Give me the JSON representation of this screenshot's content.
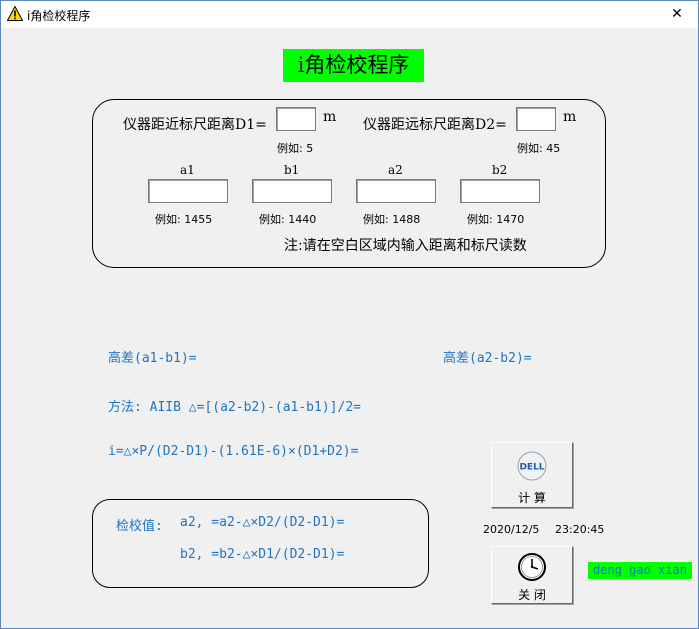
{
  "window": {
    "title": "i角检校程序",
    "close_glyph": "✕"
  },
  "header": {
    "title": "i角检校程序"
  },
  "inputs": {
    "d1_label": "仪器距近标尺距离D1=",
    "d1_unit": "m",
    "d1_value": "",
    "d1_example": "例如: 5",
    "d2_label": "仪器距远标尺距离D2=",
    "d2_unit": "m",
    "d2_value": "",
    "d2_example": "例如: 45",
    "readings": [
      {
        "label": "a1",
        "value": "",
        "example": "例如: 1455"
      },
      {
        "label": "b1",
        "value": "",
        "example": "例如: 1440"
      },
      {
        "label": "a2",
        "value": "",
        "example": "例如: 1488"
      },
      {
        "label": "b2",
        "value": "",
        "example": "例如: 1470"
      }
    ],
    "note": "注:请在空白区域内输入距离和标尺读数"
  },
  "results": {
    "diff1": "高差(a1-b1)=",
    "diff2": "高差(a2-b2)=",
    "method": "方法: AIIB   △=[(a2-b2)-(a1-b1)]/2=",
    "i_formula": "i=△×P/(D2-D1)-(1.61E-6)×(D1+D2)="
  },
  "calibration": {
    "label": "检校值:",
    "a2_formula": "a2, =a2-△×D2/(D2-D1)=",
    "b2_formula": "b2, =b2-△×D1/(D2-D1)="
  },
  "buttons": {
    "compute_label": "计 算",
    "compute_icon_text": "DELL",
    "close_label": "关 闭"
  },
  "status": {
    "date": "2020/12/5",
    "time": "23:20:45",
    "author": "deng gao xian"
  },
  "colors": {
    "accent_green": "#00ff00",
    "text_blue": "#1f74c4"
  }
}
